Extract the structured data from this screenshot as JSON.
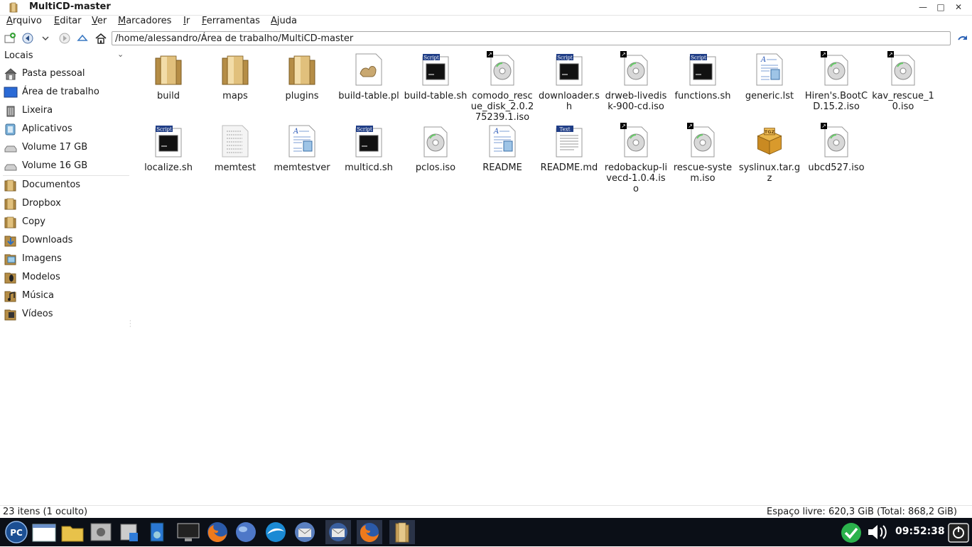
{
  "window": {
    "title": "MultiCD-master",
    "minimize": "—",
    "maximize": "□",
    "close": "✕"
  },
  "menu": [
    "Arquivo",
    "Editar",
    "Ver",
    "Marcadores",
    "Ir",
    "Ferramentas",
    "Ajuda"
  ],
  "address": {
    "path": "/home/alessandro/Área de trabalho/MultiCD-master"
  },
  "sidebar": {
    "header": "Locais",
    "items": [
      "Pasta pessoal",
      "Área de trabalho",
      "Lixeira",
      "Aplicativos",
      "Volume 17 GB",
      "Volume 16 GB",
      "Documentos",
      "Dropbox",
      "Copy",
      "Downloads",
      "Imagens",
      "Modelos",
      "Música",
      "Vídeos"
    ]
  },
  "files": [
    {
      "name": "build",
      "icon": "folder-icon"
    },
    {
      "name": "maps",
      "icon": "folder-icon"
    },
    {
      "name": "plugins",
      "icon": "folder-icon"
    },
    {
      "name": "build-table.pl",
      "icon": "perl-file-icon"
    },
    {
      "name": "build-table.sh",
      "icon": "script-file-icon"
    },
    {
      "name": "comodo_rescue_disk_2.0.275239.1.iso",
      "icon": "disc-image-icon"
    },
    {
      "name": "downloader.sh",
      "icon": "script-file-icon"
    },
    {
      "name": "drweb-livedisk-900-cd.iso",
      "icon": "disc-image-icon"
    },
    {
      "name": "functions.sh",
      "icon": "script-file-icon"
    },
    {
      "name": "generic.lst",
      "icon": "text-document-icon"
    },
    {
      "name": "Hiren's.BootCD.15.2.iso",
      "icon": "disc-image-icon"
    },
    {
      "name": "kav_rescue_10.iso",
      "icon": "disc-image-icon"
    },
    {
      "name": "localize.sh",
      "icon": "script-file-icon"
    },
    {
      "name": "memtest",
      "icon": "binary-file-icon"
    },
    {
      "name": "memtestver",
      "icon": "text-document-icon"
    },
    {
      "name": "multicd.sh",
      "icon": "script-file-icon"
    },
    {
      "name": "pclos.iso",
      "icon": "disc-image-icon"
    },
    {
      "name": "README",
      "icon": "text-document-icon"
    },
    {
      "name": "README.md",
      "icon": "plain-text-icon"
    },
    {
      "name": "redobackup-livecd-1.0.4.iso",
      "icon": "disc-image-icon"
    },
    {
      "name": "rescue-system.iso",
      "icon": "disc-image-icon"
    },
    {
      "name": "syslinux.tar.gz",
      "icon": "archive-icon"
    },
    {
      "name": "ubcd527.iso",
      "icon": "disc-image-icon"
    }
  ],
  "status": {
    "count": "23 itens (1 oculto)",
    "space": "Espaço livre: 620,3 GiB (Total: 868,2 GiB)"
  },
  "taskbar": {
    "start_label": "PC",
    "clock": "09:52:38"
  }
}
